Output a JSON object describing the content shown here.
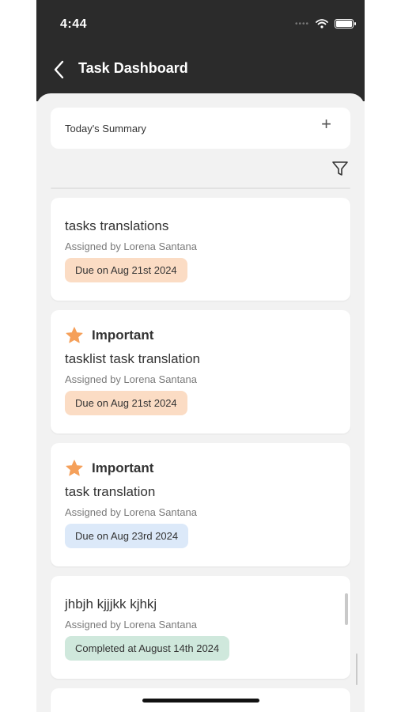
{
  "status_bar": {
    "time": "4:44"
  },
  "header": {
    "title": "Task Dashboard"
  },
  "summary": {
    "label": "Today's Summary",
    "add_symbol": "+"
  },
  "tasks": [
    {
      "important": false,
      "title": "tasks translations",
      "assigned": "Assigned by Lorena Santana",
      "due": "Due on Aug 21st 2024",
      "badge_color": "#fbdcc4"
    },
    {
      "important": true,
      "important_label": "Important",
      "title": "tasklist task translation",
      "assigned": "Assigned by Lorena Santana",
      "due": "Due on Aug 21st 2024",
      "badge_color": "#fbdcc4"
    },
    {
      "important": true,
      "important_label": "Important",
      "title": "task translation",
      "assigned": "Assigned by Lorena Santana",
      "due": "Due on Aug 23rd 2024",
      "badge_color": "#dce9f9"
    },
    {
      "important": false,
      "title": "jhbjh kjjjkk kjhkj",
      "assigned": "Assigned by Lorena Santana",
      "due": "Completed at August 14th 2024",
      "badge_color": "#cfe8dc"
    }
  ],
  "colors": {
    "header_bg": "#2b2b2b",
    "star": "#f5a05a",
    "page_bg": "#f2f2f2"
  },
  "icons": [
    "chevron-left-icon",
    "plus-icon",
    "filter-icon",
    "star-icon",
    "wifi-icon",
    "battery-icon"
  ]
}
